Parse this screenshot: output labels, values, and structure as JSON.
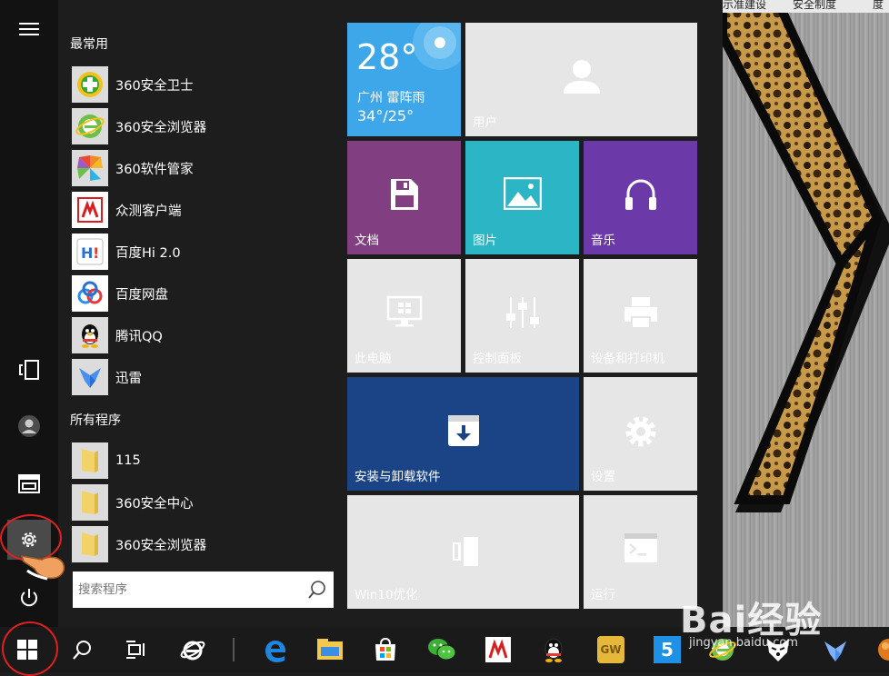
{
  "topstrip": {
    "left_text": "",
    "right_items": [
      "示准建设",
      "安全制度",
      "度"
    ]
  },
  "sections": {
    "frequent": "最常用",
    "all_programs": "所有程序"
  },
  "frequent_apps": [
    {
      "label": "360安全卫士",
      "icon": "360-safe-icon"
    },
    {
      "label": "360安全浏览器",
      "icon": "360-browser-icon"
    },
    {
      "label": "360软件管家",
      "icon": "360-software-manager-icon"
    },
    {
      "label": "众测客户端",
      "icon": "zhongce-client-icon"
    },
    {
      "label": "百度Hi 2.0",
      "icon": "baidu-hi-icon"
    },
    {
      "label": "百度网盘",
      "icon": "baidu-netdisk-icon"
    },
    {
      "label": "腾讯QQ",
      "icon": "qq-penguin-icon"
    },
    {
      "label": "迅雷",
      "icon": "xunlei-icon"
    }
  ],
  "all_apps": [
    {
      "label": "115",
      "icon": "folder-icon"
    },
    {
      "label": "360安全中心",
      "icon": "folder-icon"
    },
    {
      "label": "360安全浏览器",
      "icon": "folder-icon"
    }
  ],
  "search": {
    "placeholder": "搜索程序"
  },
  "tiles": {
    "weather": {
      "temp": "28°",
      "city_line": "广州  雷阵雨",
      "range": "34°/25°"
    },
    "user": "用户",
    "documents": "文档",
    "pictures": "图片",
    "music": "音乐",
    "this_pc": "此电脑",
    "control_panel": "控制面板",
    "devices_printers": "设备和打印机",
    "install_uninstall": "安装与卸载软件",
    "settings": "设置",
    "win10_optimize": "Win10优化",
    "run": "运行"
  },
  "taskbar_icons": [
    "windows-start-icon",
    "search-icon",
    "task-view-icon",
    "ie-icon",
    "edge-icon",
    "file-explorer-icon",
    "store-icon",
    "wechat-icon",
    "zhongce-icon",
    "qq-icon",
    "gw-icon",
    "five-icon",
    "360-browser-icon",
    "penguin-face-icon",
    "xunlei-icon",
    "orange-ball-icon"
  ],
  "taskbar_labels": {
    "gw": "GW",
    "five": "5"
  },
  "watermark": {
    "brand": "Bai经验",
    "url": "jingyan.baidu.com"
  },
  "colors": {
    "weather": "#3ea7ea",
    "documents": "#813f81",
    "pictures": "#2bb5c5",
    "music": "#6b3aa8",
    "install": "#1b4486",
    "menu_bg": "#1d1d1d"
  }
}
